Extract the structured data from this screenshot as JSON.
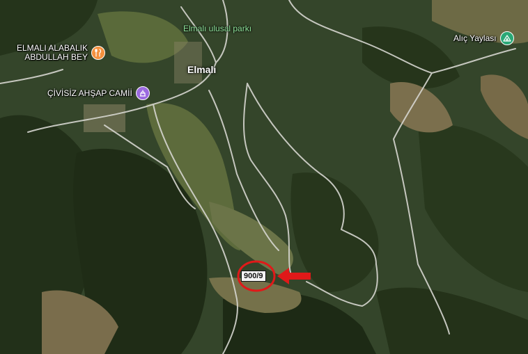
{
  "map": {
    "places": [
      {
        "id": "elmali",
        "label": "Elmalı"
      }
    ],
    "parks": [
      {
        "id": "elmali-park",
        "label": "Elmalı ulusal parkı"
      }
    ],
    "pois": {
      "restaurant": {
        "line1": "ELMALI ALABALIK",
        "line2": "ABDULLAH BEY",
        "icon": "restaurant-icon",
        "color": "#f5903d"
      },
      "mosque": {
        "label": "ÇİVİSİZ AHŞAP CAMİİ",
        "icon": "mosque-icon",
        "color": "#9b6ae0"
      },
      "highland": {
        "label": "Alıç Yaylası",
        "icon": "campground-icon",
        "color": "#2aa876"
      }
    },
    "parcel": {
      "label": "900/9"
    },
    "annotation": {
      "circle_color": "#e01919",
      "arrow_color": "#e01919"
    }
  }
}
